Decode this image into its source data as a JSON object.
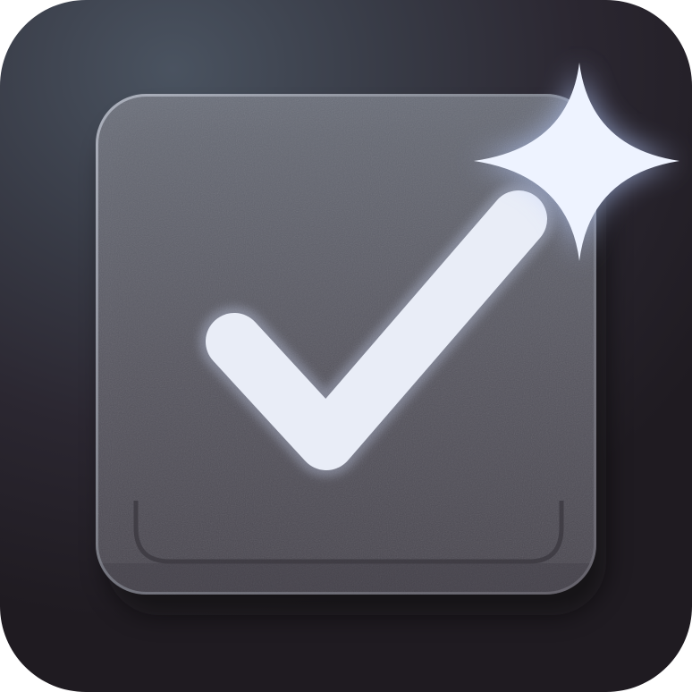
{
  "icon": {
    "subject": "checkbox-with-checkmark-and-sparkle",
    "glyphs": [
      "checkbox-icon",
      "checkmark-icon",
      "sparkle-icon"
    ],
    "state": "checked"
  },
  "colors": {
    "background_top": "#4a5360",
    "background_bottom": "#1f1b21",
    "box_fill_top": "#6b6f7a",
    "box_fill_bottom": "#4e4c56",
    "box_border": "#9aa0ac",
    "checkmark": "#e9edf7",
    "sparkle": "#eef3ff",
    "sparkle_glow": "#b9cdff"
  }
}
